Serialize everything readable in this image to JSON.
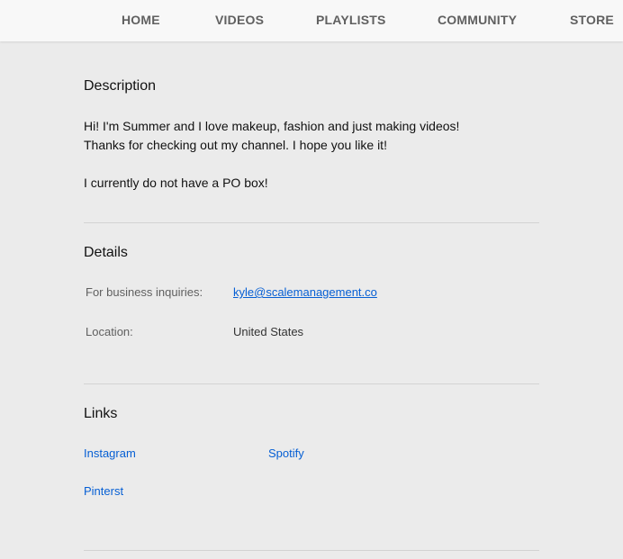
{
  "tabs": {
    "home": "HOME",
    "videos": "VIDEOS",
    "playlists": "PLAYLISTS",
    "community": "COMMUNITY",
    "store": "STORE"
  },
  "description": {
    "title": "Description",
    "lines": [
      "Hi! I'm Summer and I love makeup, fashion and just making videos!",
      "Thanks for checking out my channel. I hope you like it!",
      "I currently do not have a PO box!"
    ]
  },
  "details": {
    "title": "Details",
    "business_label": "For business inquiries:",
    "business_email": "kyle@scalemanagement.co",
    "location_label": "Location:",
    "location_value": "United States"
  },
  "links": {
    "title": "Links",
    "items": [
      "Instagram",
      "Spotify",
      "Pinterst"
    ]
  },
  "colors": {
    "link": "#065fd4",
    "background": "#ebebeb",
    "tabbar": "#f8f8f8"
  }
}
